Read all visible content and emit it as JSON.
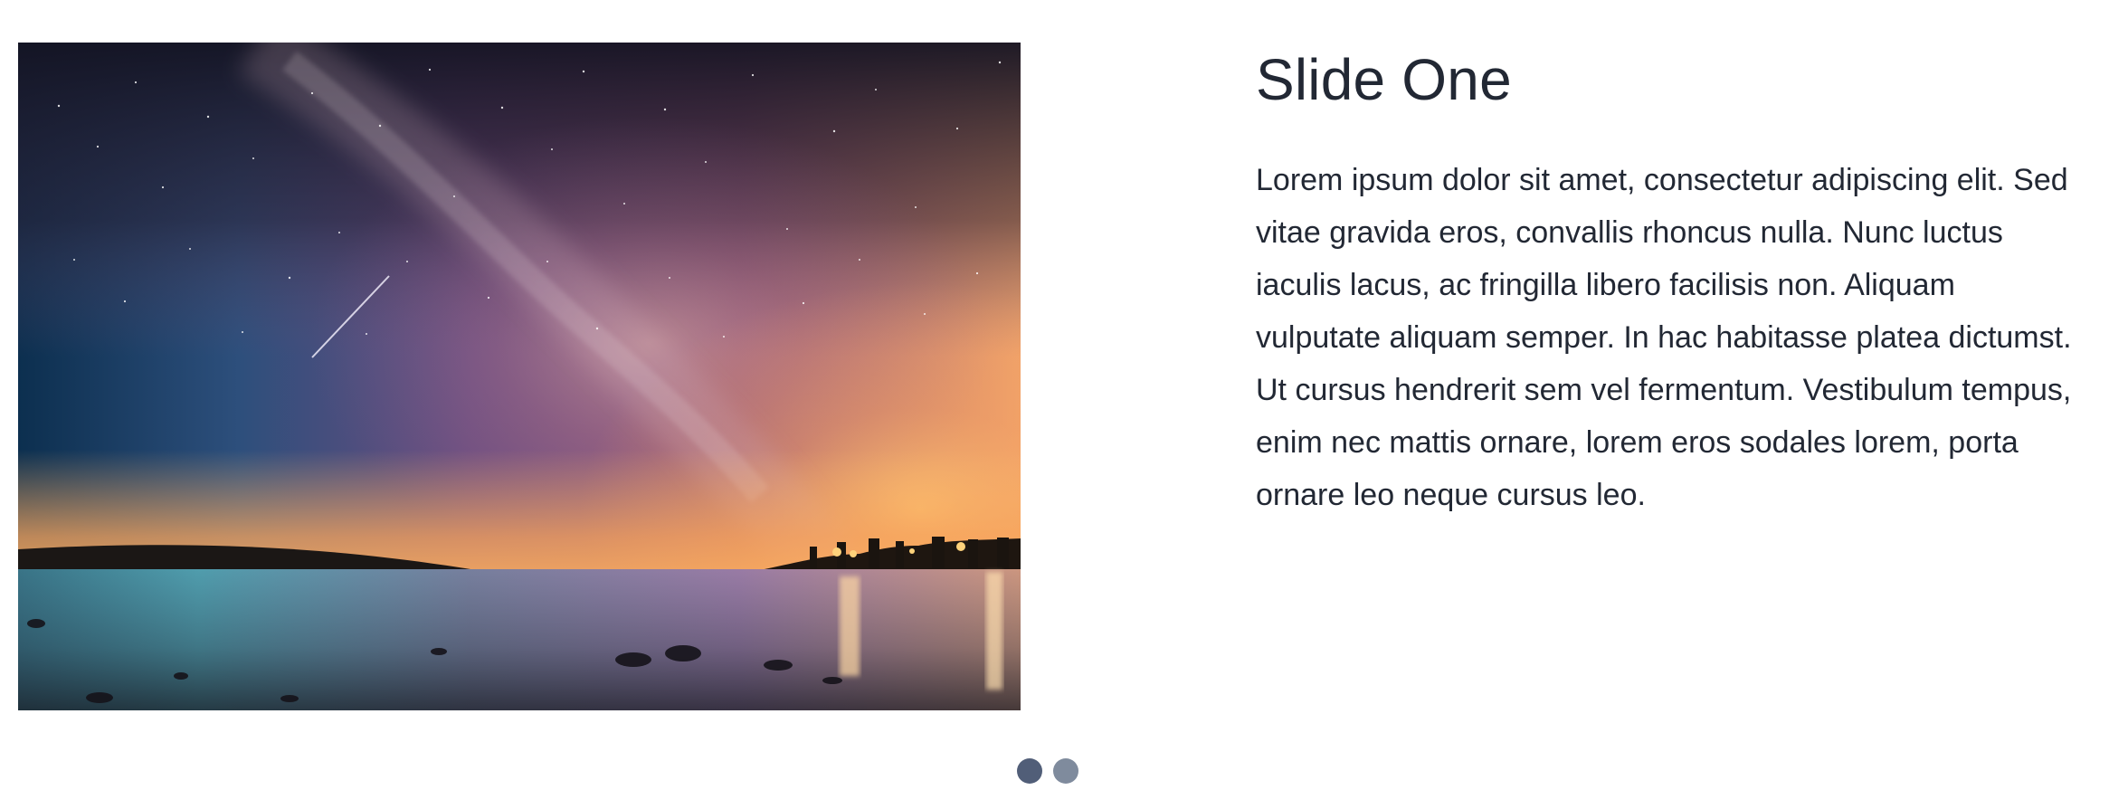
{
  "slider": {
    "active_index": 0,
    "slides": [
      {
        "title": "Slide One",
        "body": "Lorem ipsum dolor sit amet, consectetur adipiscing elit. Sed vitae gravida eros, convallis rhoncus nulla. Nunc luctus iaculis lacus, ac fringilla libero facilisis non. Aliquam vulputate aliquam semper. In hac habitasse platea dictumst. Ut cursus hendrerit sem vel fermentum. Vestibulum tempus, enim nec mattis ornare, lorem eros sodales lorem, porta ornare leo neque cursus leo."
      }
    ],
    "dots": [
      {
        "active": true
      },
      {
        "active": false
      }
    ],
    "colors": {
      "title": "#222834",
      "text": "#222834",
      "dot_active": "#515e78",
      "dot_inactive": "#7f8b9d"
    }
  }
}
